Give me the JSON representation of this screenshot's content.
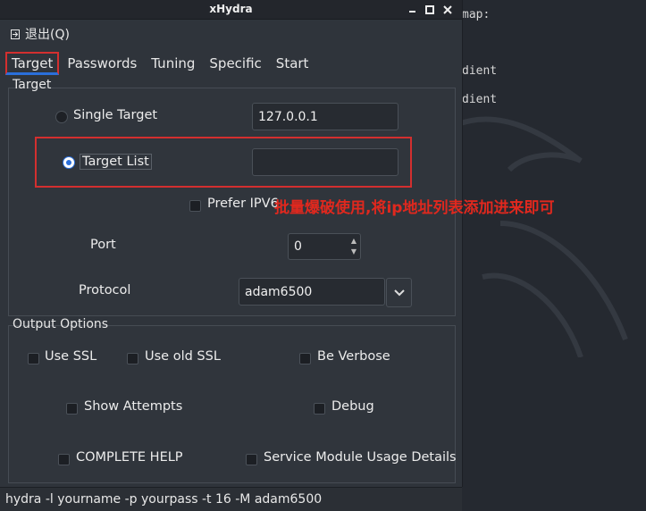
{
  "terminal": {
    "lines": [
      "map:",
      "dient",
      "dient"
    ]
  },
  "window": {
    "title": "xHydra",
    "menu": {
      "quit_label": "退出(Q)"
    }
  },
  "tabs": [
    {
      "label": "Target",
      "active": true
    },
    {
      "label": "Passwords"
    },
    {
      "label": "Tuning"
    },
    {
      "label": "Specific"
    },
    {
      "label": "Start"
    }
  ],
  "target_group": {
    "title": "Target",
    "single_target_label": "Single Target",
    "single_target_value": "127.0.0.1",
    "target_list_label": "Target List",
    "target_list_value": "",
    "selected": "Target List",
    "prefer_ipv6_label": "Prefer IPV6",
    "port_label": "Port",
    "port_value": "0",
    "protocol_label": "Protocol",
    "protocol_value": "adam6500"
  },
  "annotation": "批量爆破使用,将ip地址列表添加进来即可",
  "output_options": {
    "title": "Output Options",
    "use_ssl": "Use SSL",
    "use_old_ssl": "Use old SSL",
    "be_verbose": "Be Verbose",
    "show_attempts": "Show Attempts",
    "debug": "Debug",
    "complete_help": "COMPLETE HELP",
    "service_module_usage": "Service Module Usage Details"
  },
  "command_line": "hydra -l yourname -p yourpass -t 16 -M  adam6500",
  "colors": {
    "highlight_red": "#d32f2f",
    "accent_blue": "#2a6fdb"
  }
}
